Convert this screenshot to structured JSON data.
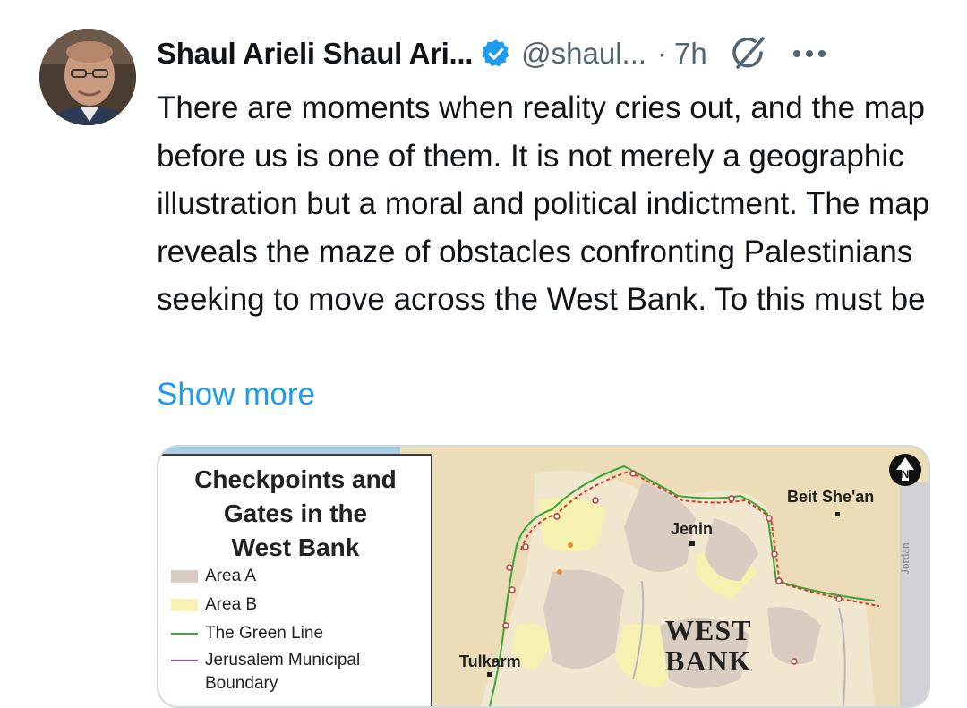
{
  "tweet": {
    "author_name": "Shaul Arieli Shaul Ari...",
    "handle": "@shaul...",
    "separator": "·",
    "time": "7h",
    "text": "There are moments when reality cries out, and the map before us is one of them. It is not merely a geographic illustration but a moral and political indictment. The map reveals the maze of obstacles confronting Palestinians seeking to move across the West Bank. To this must be",
    "show_more": "Show more"
  },
  "icons": {
    "verified": "verified-badge-icon",
    "grok": "grok-icon",
    "more": "more-options-icon",
    "north": "north-arrow-icon"
  },
  "colors": {
    "link": "#1d9bf0",
    "verified": "#1d9bf0",
    "area_a": "#d9ccc1",
    "area_b": "#f6f1b0",
    "green_line": "#3aa53a",
    "jerusalem_boundary": "#9b3fb5"
  },
  "map": {
    "legend": {
      "title_lines": [
        "Checkpoints and",
        "Gates in the",
        "West Bank"
      ],
      "items": [
        {
          "label": "Area A"
        },
        {
          "label": "Area B"
        },
        {
          "label": "The Green Line"
        },
        {
          "label": "Jerusalem Municipal",
          "label2": "Boundary"
        }
      ]
    },
    "places": {
      "jenin": "Jenin",
      "beit_shean": "Beit She'an",
      "tulkarm": "Tulkarm",
      "west": "WEST",
      "bank": "BANK",
      "jordan": "Jordan"
    }
  }
}
